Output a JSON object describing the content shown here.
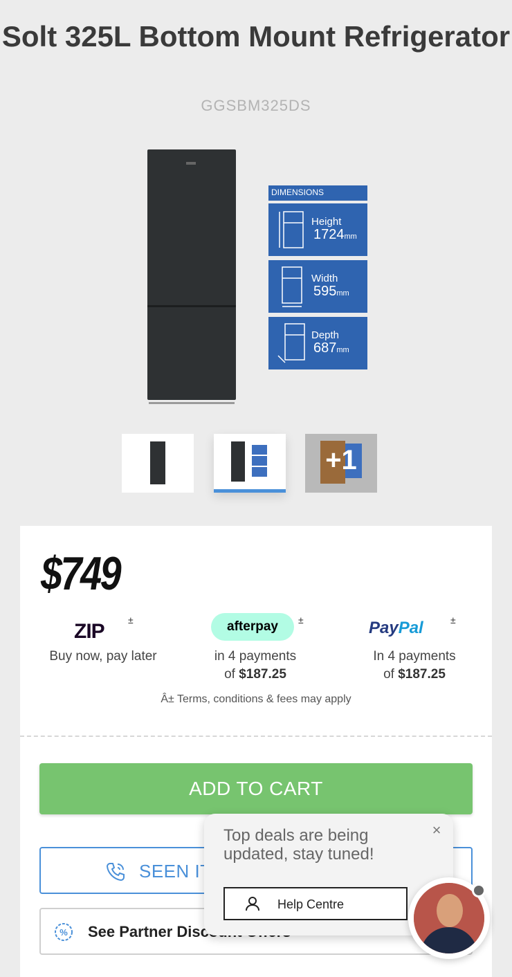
{
  "product": {
    "title": "Solt 325L Bottom Mount Refrigerator",
    "sku": "GGSBM325DS"
  },
  "dimensions": {
    "header": "DIMENSIONS",
    "height_label": "Height",
    "height_value": "1724",
    "unit": "mm",
    "width_label": "Width",
    "width_value": "595",
    "depth_label": "Depth",
    "depth_value": "687"
  },
  "thumbnails": {
    "more_label": "+1"
  },
  "pricing": {
    "price": "$749",
    "zip": {
      "logo": "ZIP",
      "mark": "±",
      "line1": "Buy now, pay later"
    },
    "afterpay": {
      "logo": "afterpay",
      "mark": "±",
      "line1": "in 4 payments",
      "line2_prefix": "of ",
      "amount": "$187.25"
    },
    "paypal": {
      "logo_pay": "Pay",
      "logo_pal": "Pal",
      "mark": "±",
      "line1": "In 4 payments",
      "line2_prefix": "of ",
      "amount": "$187.25"
    },
    "terms": "Â± Terms, conditions & fees may apply"
  },
  "actions": {
    "add_to_cart": "ADD TO CART",
    "seen_it": "SEEN IT",
    "partner": "See Partner Discount Offers"
  },
  "chat": {
    "message": "Top deals are being updated, stay tuned!",
    "help_centre": "Help Centre",
    "close": "×"
  },
  "colors": {
    "add_to_cart": "#77c46f",
    "accent_blue": "#4a90d9",
    "afterpay_mint": "#b2fce4",
    "dimensions_blue": "#2f64b0"
  }
}
